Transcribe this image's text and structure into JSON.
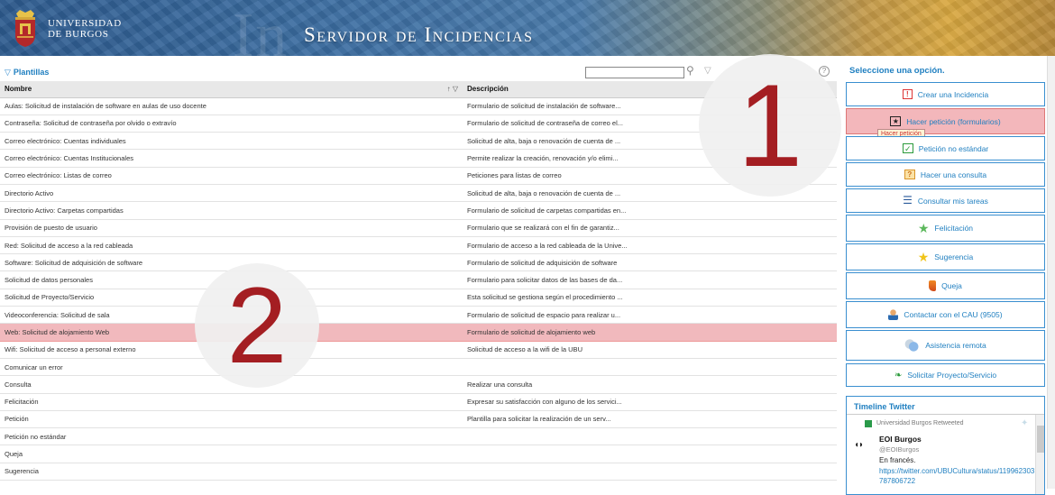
{
  "header": {
    "university_line1": "UNIVERSIDAD",
    "university_line2": "DE BURGOS",
    "title": "Servidor de Incidencias",
    "bg_letters": "In"
  },
  "left_panel": {
    "title": "Plantillas",
    "columns": {
      "name": "Nombre",
      "description": "Descripción"
    },
    "rows": [
      {
        "name": "Aulas: Solicitud de instalación de software en aulas de uso docente",
        "desc": "Formulario de solicitud de instalación de software..."
      },
      {
        "name": "Contraseña: Solicitud de contraseña por olvido o extravío",
        "desc": "Formulario de solicitud de contraseña de correo el..."
      },
      {
        "name": "Correo electrónico: Cuentas individuales",
        "desc": "Solicitud de alta, baja o renovación de cuenta de ..."
      },
      {
        "name": "Correo electrónico: Cuentas Institucionales",
        "desc": "Permite realizar la creación, renovación y/o elimi..."
      },
      {
        "name": "Correo electrónico: Listas de correo",
        "desc": "Peticiones para listas de correo"
      },
      {
        "name": "Directorio Activo",
        "desc": "Solicitud de alta, baja o renovación de cuenta de ..."
      },
      {
        "name": "Directorio Activo: Carpetas compartidas",
        "desc": "Formulario de solicitud de carpetas compartidas en..."
      },
      {
        "name": "Provisión de puesto de usuario",
        "desc": "Formulario que se realizará con el fin de garantiz..."
      },
      {
        "name": "Red: Solicitud de acceso a la red cableada",
        "desc": "Formulario de acceso a la red cableada de la Unive..."
      },
      {
        "name": "Software: Solicitud de adquisición de software",
        "desc": "Formulario de solicitud de adquisición de software"
      },
      {
        "name": "Solicitud de datos personales",
        "desc": "Formulario para solicitar datos de las bases de da..."
      },
      {
        "name": "Solicitud de Proyecto/Servicio",
        "desc": "Esta solicitud se gestiona según el procedimiento ..."
      },
      {
        "name": "Videoconferencia: Solicitud de sala",
        "desc": "Formulario de solicitud de espacio para realizar u..."
      },
      {
        "name": "Web: Solicitud de alojamiento Web",
        "desc": "Formulario de solicitud de alojamiento web",
        "selected": true
      },
      {
        "name": "Wifi: Solicitud de acceso a personal externo",
        "desc": "Solicitud de acceso a la wifi de la UBU"
      },
      {
        "name": "Comunicar un error",
        "desc": ""
      },
      {
        "name": "Consulta",
        "desc": "Realizar una consulta"
      },
      {
        "name": "Felicitación",
        "desc": "Expresar su satisfacción con alguno de los servici..."
      },
      {
        "name": "Petición",
        "desc": "Plantilla para solicitar la realización de un serv..."
      },
      {
        "name": "Petición no estándar",
        "desc": ""
      },
      {
        "name": "Queja",
        "desc": ""
      },
      {
        "name": "Sugerencia",
        "desc": ""
      }
    ]
  },
  "right_panel": {
    "title": "Seleccione una opción.",
    "options": [
      {
        "label": "Crear una Incidencia",
        "icon": "alert-icon"
      },
      {
        "label": "Hacer petición (formularios)",
        "icon": "star-box-icon"
      },
      {
        "label": "Petición no estándar",
        "icon": "checkbox-icon"
      },
      {
        "label": "Hacer una consulta",
        "icon": "question-icon"
      },
      {
        "label": "Consultar mis tareas",
        "icon": "list-icon"
      },
      {
        "label": "Felicitación",
        "icon": "star-green-icon"
      },
      {
        "label": "Sugerencia",
        "icon": "star-yellow-icon"
      },
      {
        "label": "Queja",
        "icon": "boot-icon"
      },
      {
        "label": "Contactar con el CAU (9505)",
        "icon": "person-icon"
      },
      {
        "label": "Asistencia remota",
        "icon": "remote-icon"
      },
      {
        "label": "Solicitar Proyecto/Servicio",
        "icon": "leaf-icon"
      }
    ],
    "tooltip": "Hacer petición",
    "twitter": {
      "title": "Timeline Twitter",
      "retweet": "Universidad Burgos Retweeted",
      "account_name": "EOI Burgos",
      "handle": "@EOIBurgos",
      "text": "En francés.",
      "link": "https://twitter.com/UBUCultura/status/1199623031787806722"
    }
  },
  "annotations": {
    "one": "1",
    "two": "2"
  },
  "colors": {
    "accent": "#1f7fc0",
    "selection": "#f1b9bd",
    "annotation": "#a41e22"
  }
}
